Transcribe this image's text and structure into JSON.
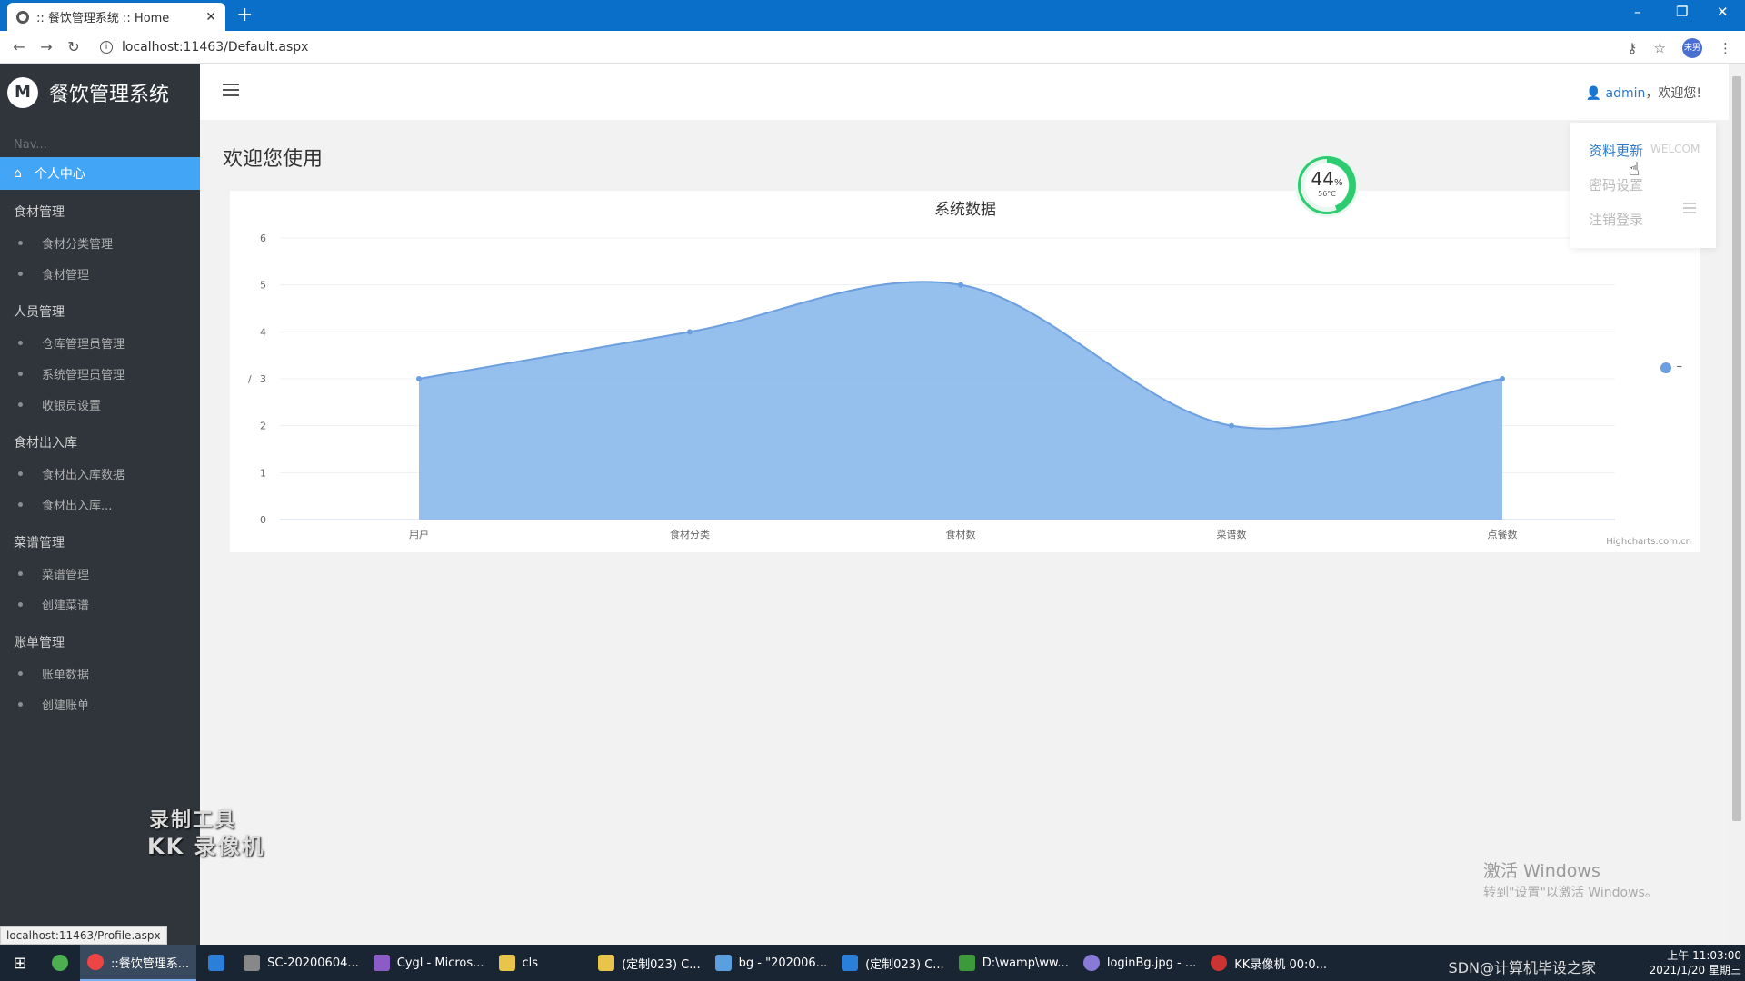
{
  "browser": {
    "tab_title": ":: 餐饮管理系统 :: Home",
    "url": "localhost:11463/Default.aspx",
    "status_url": "localhost:11463/Profile.aspx",
    "profile_label": "宋男"
  },
  "sidebar": {
    "brand": "餐饮管理系统",
    "nav_label": "Nav...",
    "active_item": "个人中心",
    "groups": [
      {
        "title": "食材管理",
        "items": [
          "食材分类管理",
          "食材管理"
        ]
      },
      {
        "title": "人员管理",
        "items": [
          "仓库管理员管理",
          "系统管理员管理",
          "收银员设置"
        ]
      },
      {
        "title": "食材出入库",
        "items": [
          "食材出入库数据",
          "食材出入库..."
        ]
      },
      {
        "title": "菜谱管理",
        "items": [
          "菜谱管理",
          "创建菜谱"
        ]
      },
      {
        "title": "账单管理",
        "items": [
          "账单数据",
          "创建账单"
        ]
      }
    ]
  },
  "header": {
    "username": "admin",
    "greeting": "，欢迎您!"
  },
  "main": {
    "welcome": "欢迎您使用",
    "credits": "Highcharts.com.cn",
    "legend_label": "–"
  },
  "gauge": {
    "percent": "44",
    "percent_unit": "%",
    "temp": "56°C",
    "value": 44
  },
  "dropdown": {
    "items": [
      "资料更新",
      "密码设置",
      "注销登录"
    ],
    "welcome_text": "WELCOM"
  },
  "watermark": {
    "line1": "录制工具",
    "line2": "KK 录像机"
  },
  "activate": {
    "line1": "激活 Windows",
    "line2": "转到\"设置\"以激活 Windows。"
  },
  "taskbar": {
    "items": [
      "::餐饮管理系...",
      "SC-20200604...",
      "Cygl - Micros...",
      "cls",
      "(定制023) C...",
      "bg - \"202006...",
      "(定制023) C...",
      "D:\\wamp\\ww...",
      "loginBg.jpg - ...",
      "KK录像机 00:0..."
    ],
    "tray_text": "SDN@计算机毕设之家",
    "time": "上午 11:03:00",
    "date": "2021/1/20 星期三"
  },
  "chart_data": {
    "type": "area",
    "title": "系统数据",
    "categories": [
      "用户",
      "食材分类",
      "食材数",
      "菜谱数",
      "点餐数"
    ],
    "values": [
      3,
      4,
      5,
      2,
      3
    ],
    "ylim": [
      0,
      6
    ],
    "yticks": [
      0,
      1,
      2,
      3,
      4,
      5,
      6
    ],
    "ylabel": "/",
    "grid": true,
    "legend": "right",
    "color": "#8ab8ea"
  }
}
